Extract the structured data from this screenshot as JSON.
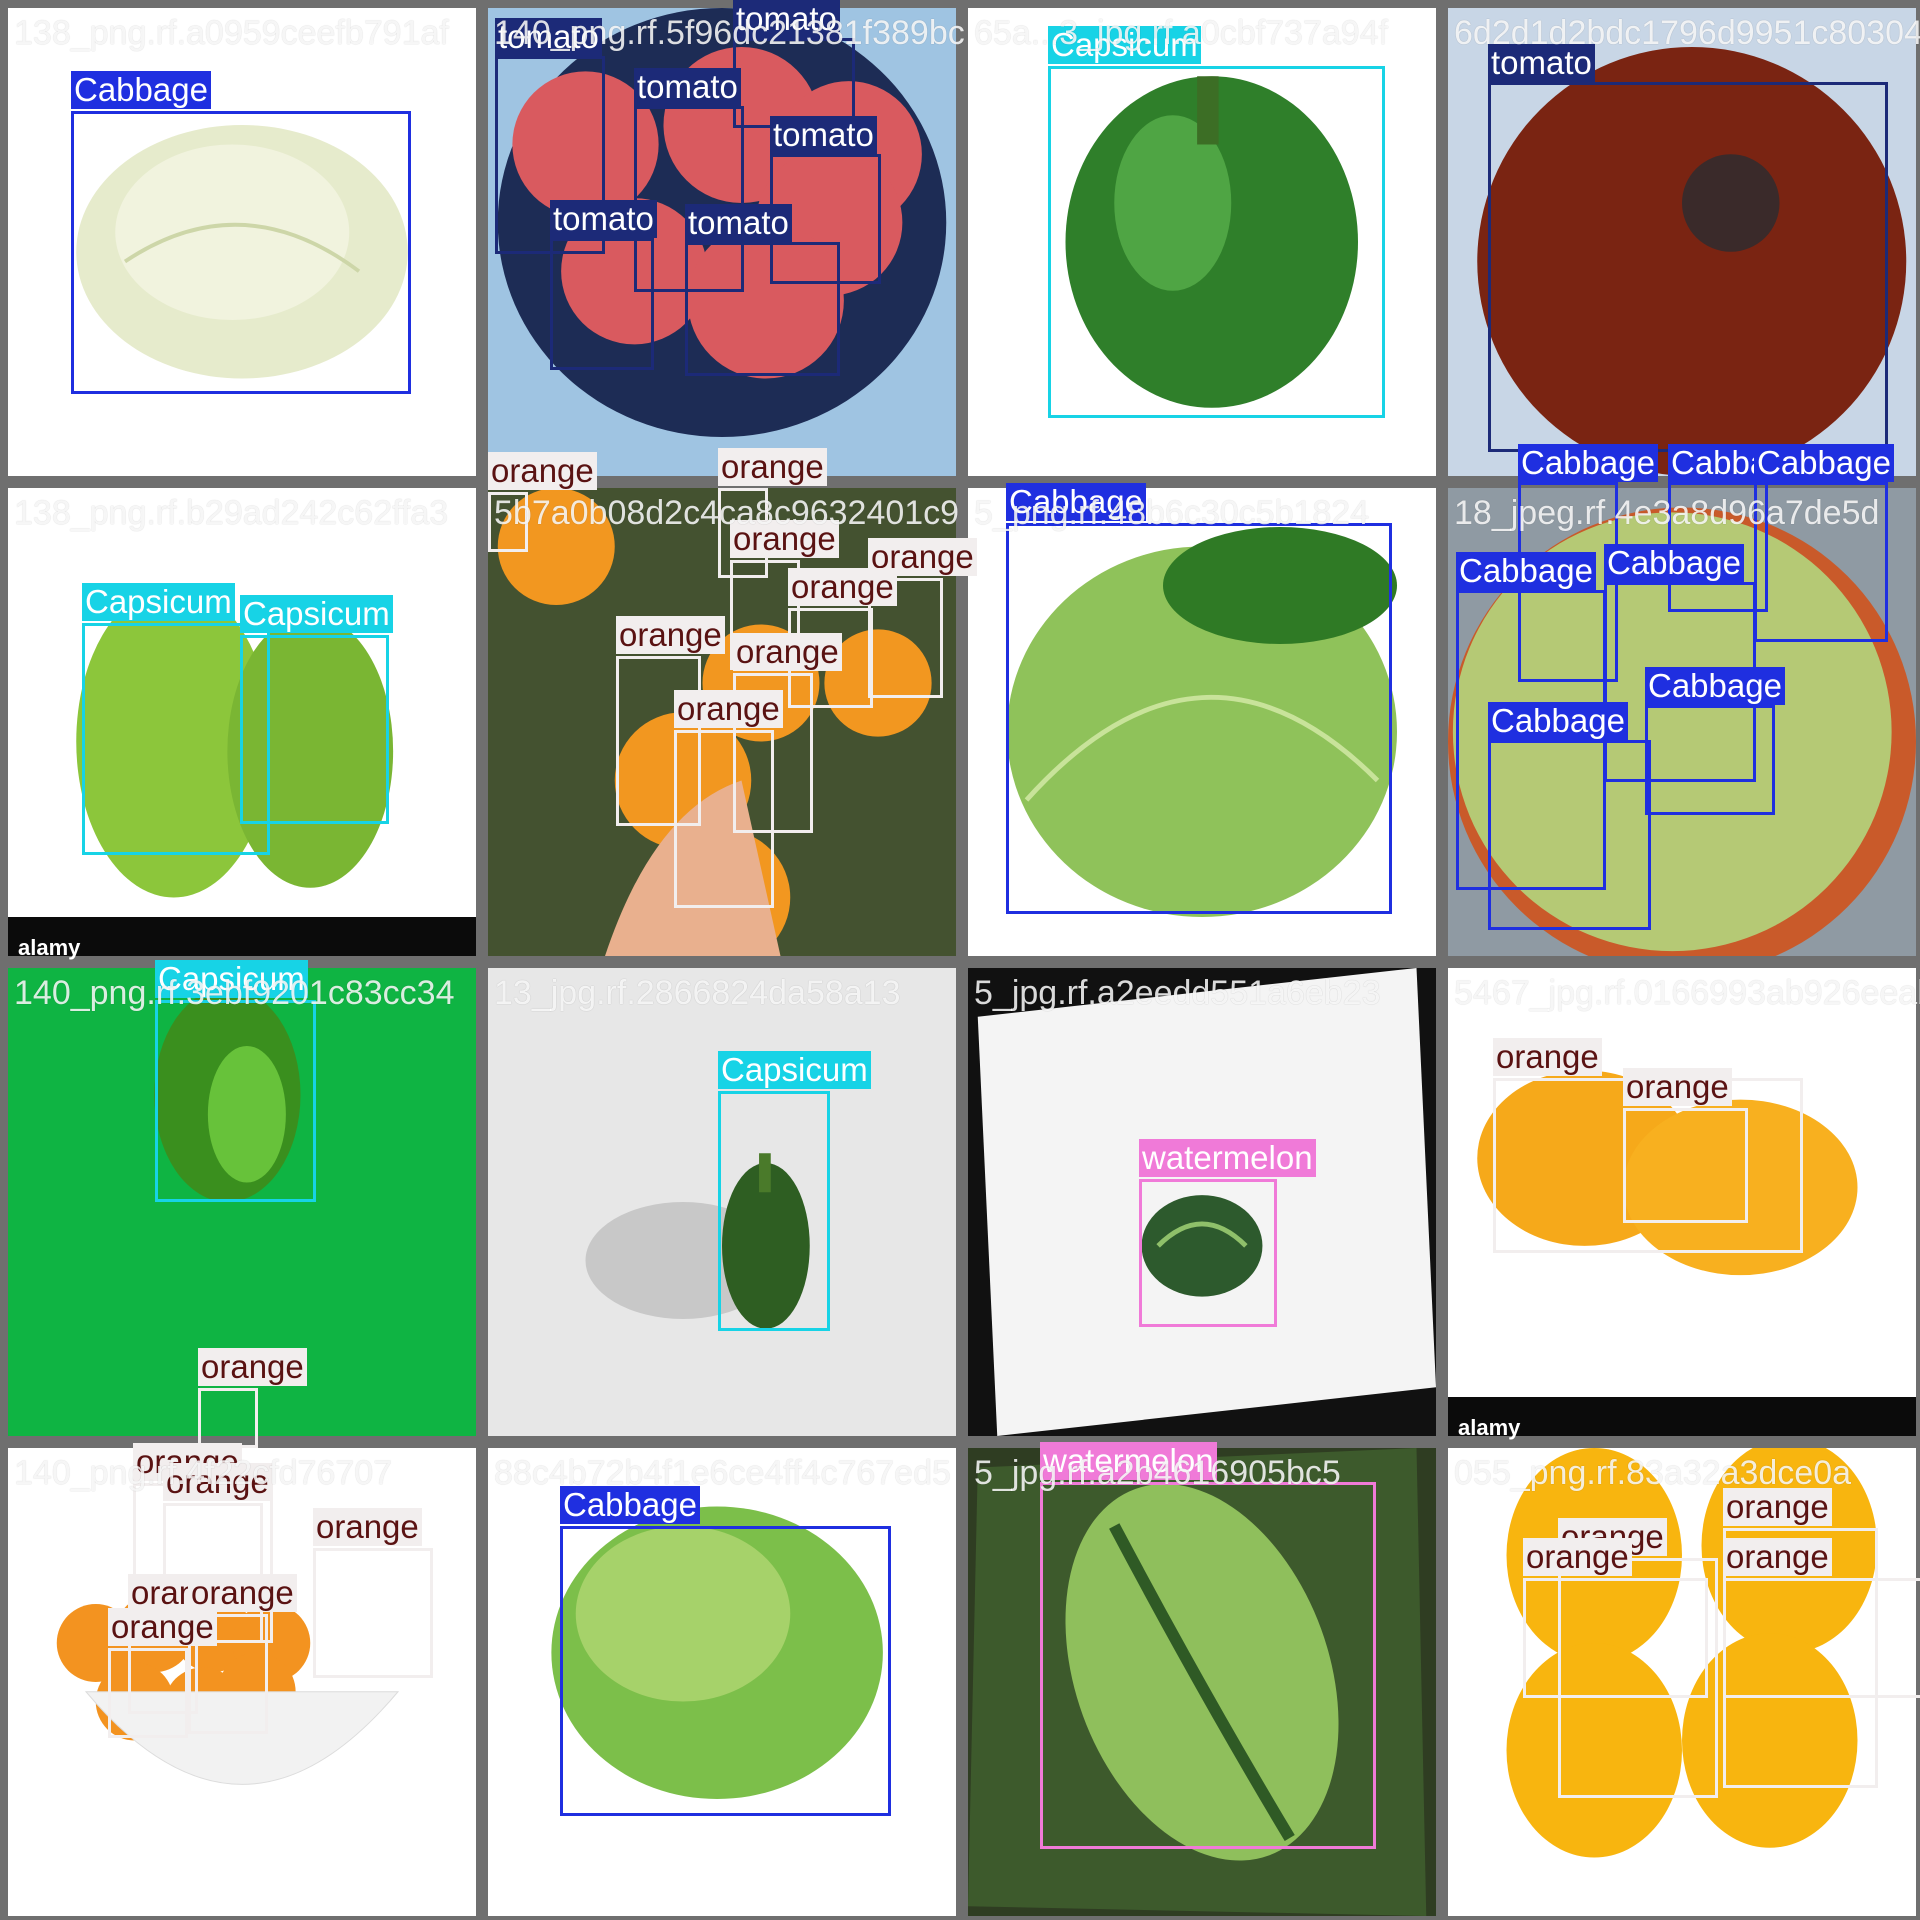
{
  "classes": {
    "Cabbage": {
      "color": "#1f2fe0",
      "text": "#ffffff"
    },
    "tomato": {
      "color": "#1c2a78",
      "text": "#ffffff"
    },
    "Capsicum": {
      "color": "#17d3e6",
      "text": "#ffffff"
    },
    "orange": {
      "color": "#f2eeee",
      "text": "#5a1212"
    },
    "watermelon": {
      "color": "#f07ad8",
      "text": "#ffffff"
    }
  },
  "tiles": [
    {
      "name": "138_png.rf.a0959ceefb791af",
      "labels": [
        "Cabbage"
      ]
    },
    {
      "name": "140_png.rf.5f96dc21381f389bc",
      "labels": [
        "tomato",
        "tomato",
        "tomato",
        "tomato",
        "tomato",
        "tomato"
      ]
    },
    {
      "name": "65a...3_jpg.rf.a0cbf737a94f",
      "labels": [
        "Capsicum"
      ]
    },
    {
      "name": "6d2d1d2bdc1796d9951c80304",
      "labels": [
        "tomato"
      ]
    },
    {
      "name": "138_png.rf.b29ad242c62ffa3",
      "labels": [
        "Capsicum",
        "Capsicum"
      ]
    },
    {
      "name": "5b7a0b08d2c4ca8c9632401c9",
      "labels": [
        "orange",
        "orange",
        "orange",
        "orange",
        "orange",
        "orange",
        "orange",
        "orange"
      ]
    },
    {
      "name": "5_png.rf.48b6c30c5b1824",
      "labels": [
        "Cabbage"
      ]
    },
    {
      "name": "18_jpeg.rf.4e3a8d96a7de5d",
      "labels": [
        "Cabbage",
        "Cabbage",
        "Cabbage",
        "Cabbage",
        "Cabbage",
        "Cabbage",
        "Cabbage"
      ]
    },
    {
      "name": "140_png.rf.3ebf9201c83cc34",
      "labels": [
        "Capsicum"
      ]
    },
    {
      "name": "13_jpg.rf.2866824da58a13",
      "labels": [
        "Capsicum"
      ]
    },
    {
      "name": "5_jpg.rf.a2eedd551a6eb23",
      "labels": [
        "watermelon"
      ]
    },
    {
      "name": "5467_jpg.rf.0166993ab926eeab",
      "labels": [
        "orange",
        "orange"
      ]
    },
    {
      "name": "140_png.rf.4f22cfd76707",
      "labels": [
        "orange",
        "orange",
        "orange",
        "orange",
        "orange",
        "orange",
        "orange"
      ]
    },
    {
      "name": "88c4b72b4f1e6ce4ff4c767ed5",
      "labels": [
        "Cabbage"
      ]
    },
    {
      "name": "5_jpg.rf.a2b4616905bc5",
      "labels": [
        "watermelon"
      ]
    },
    {
      "name": "055_png.rf.83a32a3dce0a",
      "labels": [
        "orange",
        "orange",
        "orange",
        "orange"
      ]
    }
  ],
  "watermarks": {
    "brand": "alamy"
  }
}
